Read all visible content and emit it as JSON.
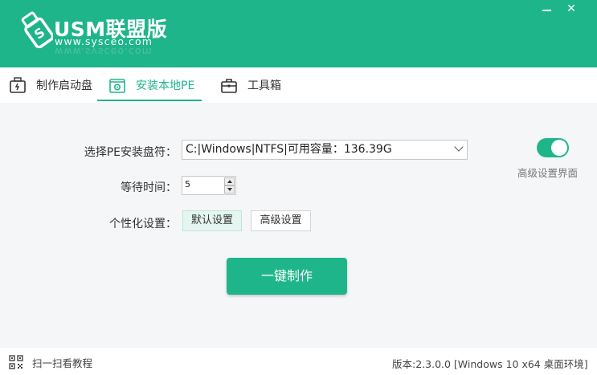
{
  "header": {
    "title": "USM联盟版",
    "url": "www.sysceo.com",
    "brand_color": "#1fb58a",
    "minimize_icon": "minimize-icon",
    "close_icon": "close-icon"
  },
  "tabs": [
    {
      "label": "制作启动盘",
      "icon": "usb-drive-icon",
      "active": false
    },
    {
      "label": "安装本地PE",
      "icon": "gear-box-icon",
      "active": true
    },
    {
      "label": "工具箱",
      "icon": "toolbox-icon",
      "active": false
    }
  ],
  "form": {
    "partition_label": "选择PE安装盘符：",
    "partition_value": "C:|Windows|NTFS|可用容量：136.39G",
    "wait_label": "等待时间：",
    "wait_value": "5",
    "custom_label": "个性化设置：",
    "default_btn": "默认设置",
    "advanced_btn": "高级设置"
  },
  "advanced_toggle": {
    "label": "高级设置界面",
    "on": true
  },
  "action": {
    "label": "一键制作"
  },
  "footer": {
    "scan_label": "扫一扫看教程",
    "version": "版本:2.3.0.0 [Windows 10 x64 桌面环境]"
  }
}
